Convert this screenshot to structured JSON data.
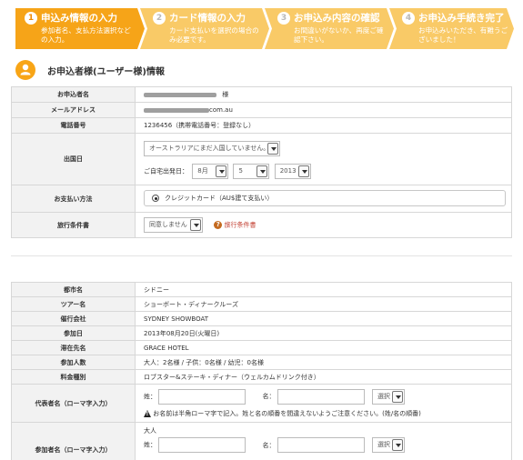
{
  "steps": [
    {
      "num": "1",
      "title": "申込み情報の入力",
      "desc": "参加者名、支払方法選択などの入力。",
      "state": "active"
    },
    {
      "num": "2",
      "title": "カード情報の入力",
      "desc": "カード支払いを選択の場合のみ必要です。",
      "state": "inactive"
    },
    {
      "num": "3",
      "title": "お申込み内容の確認",
      "desc": "お間違いがないか、再度ご確認下さい。",
      "state": "inactive"
    },
    {
      "num": "4",
      "title": "お申込み手続き完了",
      "desc": "お申込みいただき、有難うございました！",
      "state": "inactive"
    }
  ],
  "colors": {
    "active": "#f6a418",
    "inactive": "#f9ca67",
    "label_bg": "#f2f2f2",
    "border": "#d7d7d7"
  },
  "section": {
    "title": "お申込者様(ユーザー様)情報",
    "icon": "user-icon"
  },
  "applicant": {
    "name_label": "お申込者名",
    "name_suffix": "様",
    "email_label": "メールアドレス",
    "email_domain": "com.au",
    "phone_label": "電話番号",
    "phone_value": "1236456（携帯電話番号：登録なし）",
    "date_label": "出国日",
    "date_select": "オーストラリアにまだ入国していません。",
    "home_date_label": "ご自宅出発日：",
    "month": "8月",
    "day": "5",
    "year": "2013",
    "pay_label": "お支払い方法",
    "pay_option": "クレジットカード（AU$建て支払い）",
    "terms_label": "旅行条件書",
    "terms_select": "同意しません",
    "terms_link": "旅行条件書"
  },
  "tour": {
    "city_label": "都市名",
    "city": "シドニー",
    "tour_label": "ツアー名",
    "tour": "ショーボート・ディナークルーズ",
    "company_label": "催行会社",
    "company": "SYDNEY SHOWBOAT",
    "date_label": "参加日",
    "date": "2013年08月20日(火曜日)",
    "hotel_label": "滞在先名",
    "hotel": "GRACE HOTEL",
    "people_label": "参加人数",
    "people": "大人：2名様 / 子供：0名様 / 幼児：0名様",
    "fare_label": "料金種別",
    "fare": "ロブスター&ステーキ・ディナー（ウェルカムドリンク付き）",
    "rep_label": "代表者名（ローマ字入力）",
    "sei": "姓：",
    "mei": "名：",
    "select": "選択",
    "warn_text": "お名前は半角ローマ字で記入。姓と名の順番を間違えないようご注意ください。(姓/名の順番)",
    "participant_label": "参加者名（ローマ字入力）",
    "adult": "大人"
  }
}
